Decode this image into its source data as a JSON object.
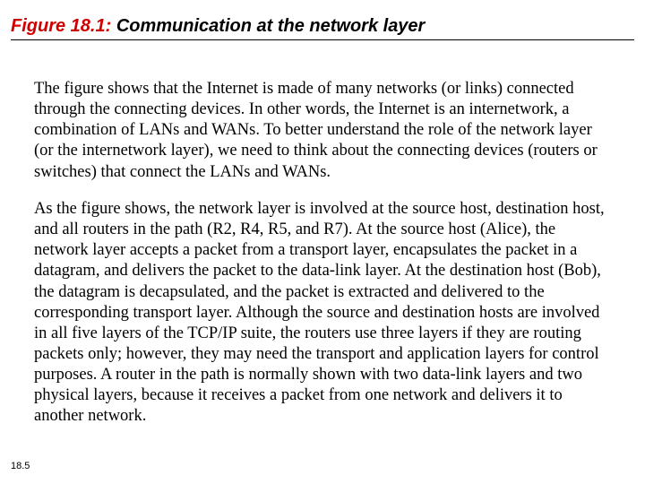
{
  "figure": {
    "number": "Figure 18.1:",
    "title": "Communication at the network layer"
  },
  "paragraphs": {
    "p1": "The figure shows that the Internet is made of many networks (or links) connected through the connecting devices. In other words, the Internet is an internetwork, a combination of LANs and WANs. To better understand the role of the network layer (or the internetwork layer), we need to think about the connecting devices (routers or switches) that connect the LANs and WANs.",
    "p2": "As the figure shows, the network layer is involved at the source host, destination host, and all routers in the path (R2, R4, R5, and R7). At the source host (Alice), the network layer accepts a packet from a transport layer, encapsulates the packet in a datagram, and delivers the packet to the data-link layer. At the destination host (Bob), the datagram is decapsulated, and the packet is extracted and delivered to the corresponding transport layer. Although the source and destination hosts are involved in all five layers of the TCP/IP suite, the routers use three layers if they are routing packets only; however, they may need the transport and application layers for control purposes. A router in the path is normally shown with two data-link layers and two physical layers, because it receives a packet from one network and delivers it to another network."
  },
  "page_number": "18.5"
}
